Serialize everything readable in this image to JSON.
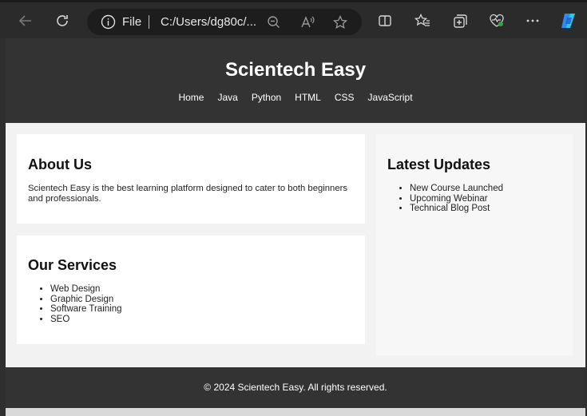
{
  "browser": {
    "address_label": "File",
    "address_url": "C:/Users/dg80c/..."
  },
  "site": {
    "title": "Scientech Easy",
    "nav": [
      "Home",
      "Java",
      "Python",
      "HTML",
      "CSS",
      "JavaScript"
    ],
    "about": {
      "heading": "About Us",
      "text": "Scientech Easy is the best learning platform designed to cater to both beginners and professionals."
    },
    "services": {
      "heading": "Our Services",
      "items": [
        "Web Design",
        "Graphic Design",
        "Software Training",
        "SEO"
      ]
    },
    "updates": {
      "heading": "Latest Updates",
      "items": [
        "New Course Launched",
        "Upcoming Webinar",
        "Technical Blog Post"
      ]
    },
    "footer": "© 2024 Scientech Easy. All rights reserved."
  }
}
